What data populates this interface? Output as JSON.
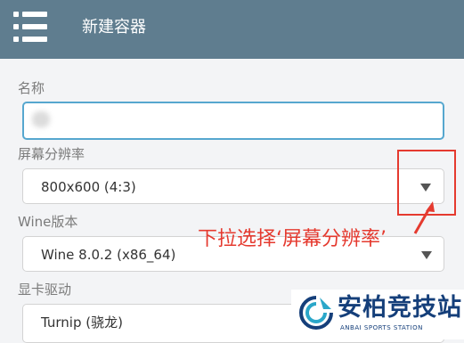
{
  "app_bar": {
    "menu_icon": "hamburger-menu-icon",
    "title": "新建容器"
  },
  "form": {
    "name": {
      "label": "名称",
      "value": ""
    },
    "resolution": {
      "label": "屏幕分辨率",
      "value": "800x600 (4:3)"
    },
    "wine_version": {
      "label": "Wine版本",
      "value": "Wine 8.0.2 (x86_64)"
    },
    "gpu_driver": {
      "label": "显卡驱动",
      "value": "Turnip (骁龙)"
    }
  },
  "annotation": {
    "text": "下拉选择‘屏幕分辨率’",
    "color": "#e53a2f"
  },
  "watermark": {
    "name_cn": "安柏竞技站",
    "name_en": "ANBAI SPORTS STATION"
  },
  "colors": {
    "app_bar": "#5f7d8f",
    "focus_border": "#56a7cf",
    "brand_blue": "#153f7a"
  }
}
